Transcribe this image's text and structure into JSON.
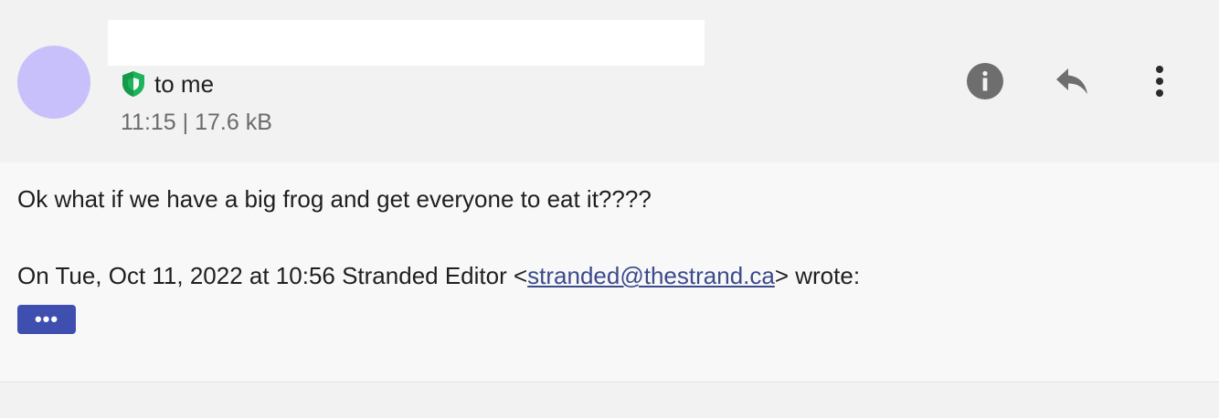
{
  "header": {
    "recipient_label": "to me",
    "time": "11:15",
    "separator": "|",
    "size": "17.6 kB",
    "icons": {
      "security": "shield-icon",
      "info": "info-icon",
      "reply": "reply-icon",
      "more": "more-vertical-icon"
    }
  },
  "message": {
    "body": "Ok what if we have a big frog and get everyone to eat it????",
    "quote_prefix": "On Tue, Oct 11, 2022 at 10:56 Stranded Editor <",
    "quote_email": "stranded@thestrand.ca",
    "quote_suffix": "> wrote:",
    "expand_label": "•••"
  },
  "colors": {
    "avatar": "#c8c0fb",
    "shield": "#1fb35b",
    "link": "#3b4a8c",
    "expand_button": "#3f4fb0",
    "icon_gray": "#6e6e6e"
  }
}
